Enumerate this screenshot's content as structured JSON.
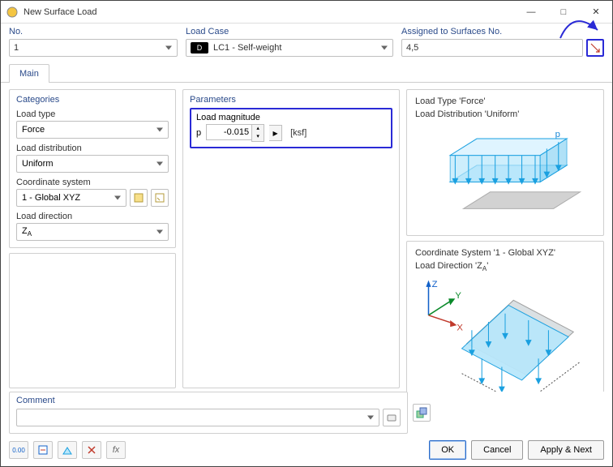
{
  "window": {
    "title": "New Surface Load"
  },
  "header": {
    "no_label": "No.",
    "no_value": "1",
    "lc_label": "Load Case",
    "lc_swatch": "D",
    "lc_value": "LC1 - Self-weight",
    "assigned_label": "Assigned to Surfaces No.",
    "assigned_value": "4,5"
  },
  "tabs": {
    "main": "Main"
  },
  "categories": {
    "panel_title": "Categories",
    "load_type_label": "Load type",
    "load_type_value": "Force",
    "load_dist_label": "Load distribution",
    "load_dist_value": "Uniform",
    "coord_sys_label": "Coordinate system",
    "coord_sys_value": "1 - Global XYZ",
    "load_dir_label": "Load direction",
    "load_dir_value": "Z",
    "load_dir_sub": "A"
  },
  "parameters": {
    "panel_title": "Parameters",
    "group_label": "Load magnitude",
    "symbol": "p",
    "value": "-0.015",
    "unit": "[ksf]"
  },
  "preview": {
    "line1a": "Load Type ",
    "line1b": "Force",
    "line2a": "Load Distribution ",
    "line2b": "Uniform",
    "p_label": "p",
    "line3a": "Coordinate System ",
    "line3b": "1 - Global XYZ",
    "line4a": "Load Direction ",
    "line4b": "Z",
    "line4sub": "A",
    "axis_z": "Z",
    "axis_y": "Y",
    "axis_x": "X"
  },
  "comment": {
    "title": "Comment",
    "value": ""
  },
  "buttons": {
    "ok": "OK",
    "cancel": "Cancel",
    "apply_next": "Apply & Next"
  },
  "bottom_icons": [
    "units-icon",
    "calc-icon",
    "show-icon",
    "delete-icon",
    "fx-icon"
  ],
  "colors": {
    "accent": "#2a4a8a",
    "highlight": "#2a2ad6"
  }
}
